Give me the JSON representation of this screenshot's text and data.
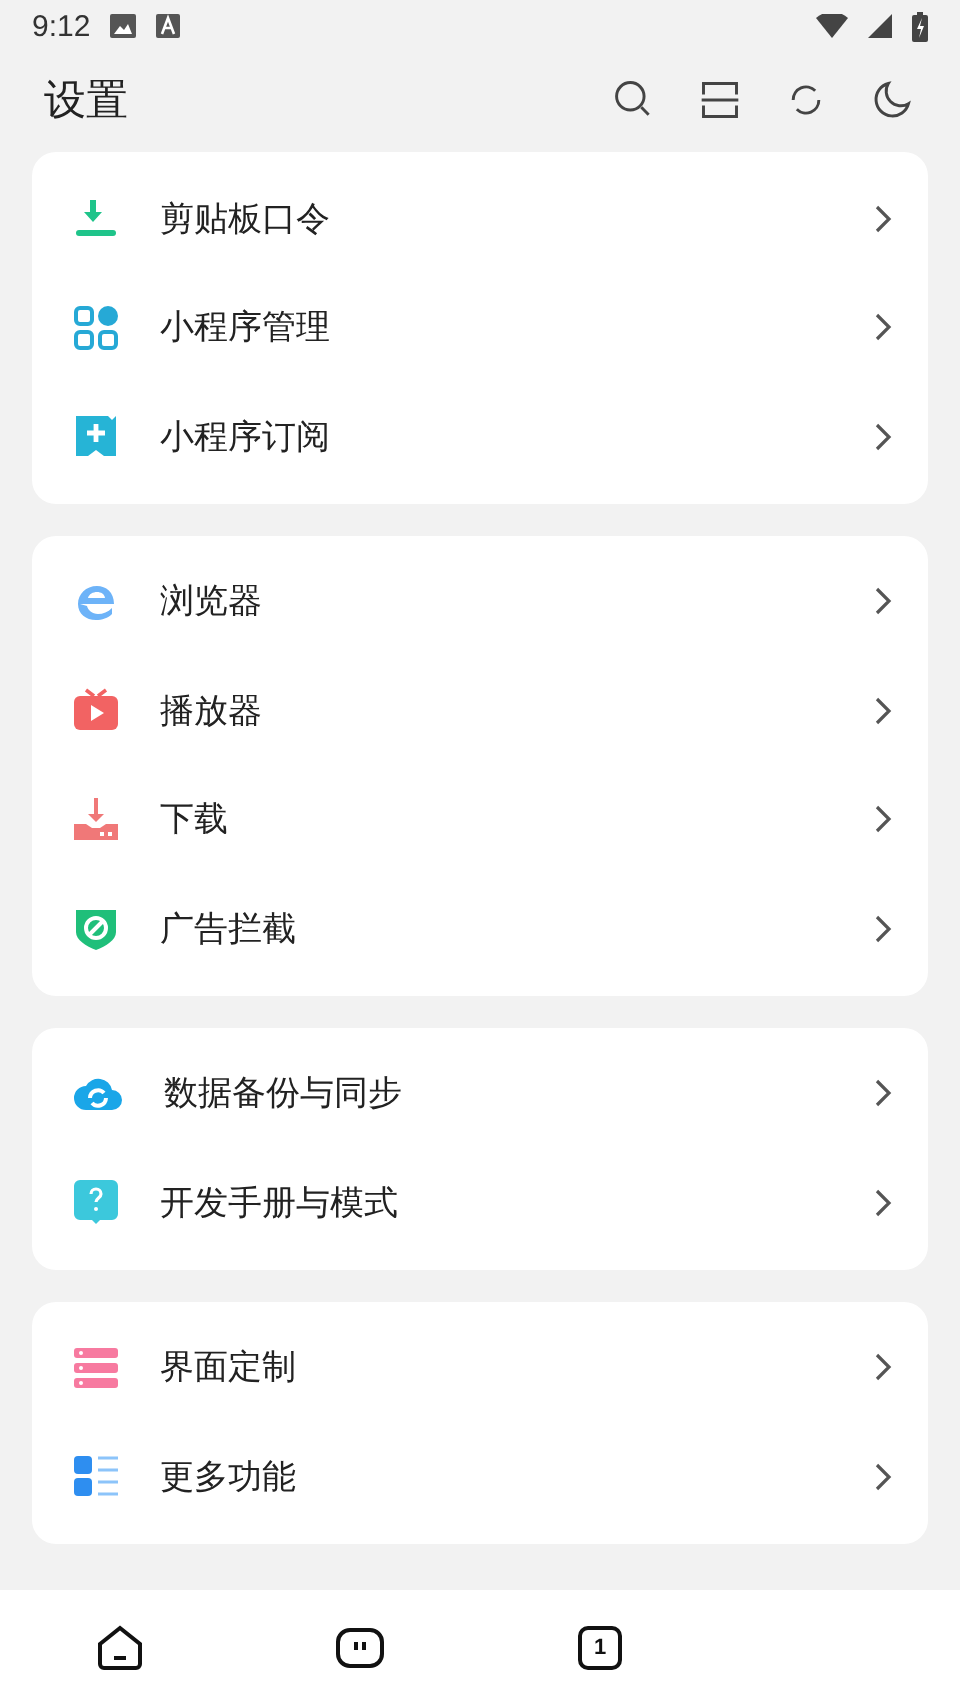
{
  "status_bar": {
    "time": "9:12"
  },
  "header": {
    "title": "设置"
  },
  "groups": [
    {
      "items": [
        {
          "label": "剪贴板口令"
        },
        {
          "label": "小程序管理"
        },
        {
          "label": "小程序订阅"
        }
      ]
    },
    {
      "items": [
        {
          "label": "浏览器"
        },
        {
          "label": "播放器"
        },
        {
          "label": "下载"
        },
        {
          "label": "广告拦截"
        }
      ]
    },
    {
      "items": [
        {
          "label": "数据备份与同步"
        },
        {
          "label": "开发手册与模式"
        }
      ]
    },
    {
      "items": [
        {
          "label": "界面定制"
        },
        {
          "label": "更多功能"
        }
      ]
    }
  ],
  "bottom_nav": {
    "tab_count": "1"
  }
}
